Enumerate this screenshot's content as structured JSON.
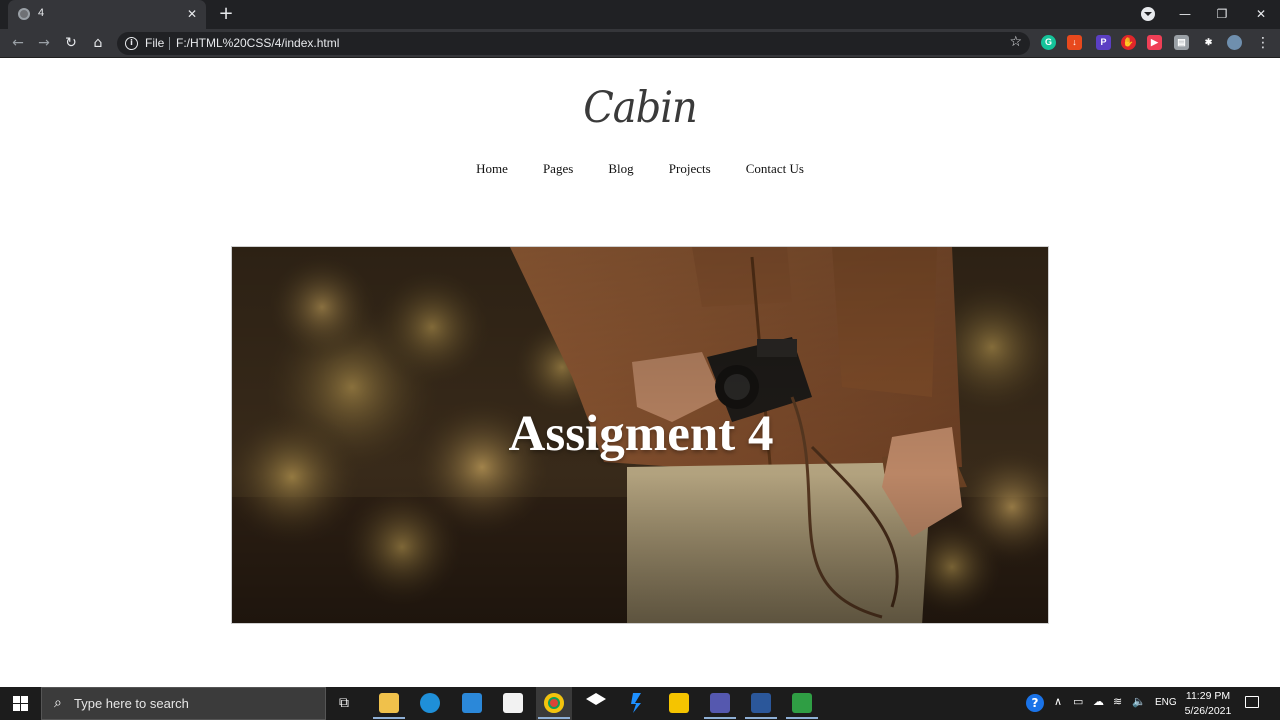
{
  "browser": {
    "tab_title": "4",
    "url_scheme": "File",
    "url": "F:/HTML%20CSS/4/index.html"
  },
  "site": {
    "logo": "Cabin",
    "nav": [
      "Home",
      "Pages",
      "Blog",
      "Projects",
      "Contact Us"
    ],
    "hero_title": "Assigment 4"
  },
  "extensions": [
    {
      "name": "grammarly-icon",
      "color": "#15c39a",
      "glyph": "G"
    },
    {
      "name": "download-extension-icon",
      "color": "#e8491d",
      "glyph": "↓"
    },
    {
      "name": "extension-badge-icon",
      "color": "#5b3fc4",
      "glyph": "P"
    },
    {
      "name": "adblock-icon",
      "color": "#e0262a",
      "glyph": "✋"
    },
    {
      "name": "pocket-icon",
      "color": "#ef3f56",
      "glyph": "▶"
    },
    {
      "name": "extension-grey-icon",
      "color": "#9aa0a6",
      "glyph": "▤"
    },
    {
      "name": "puzzle-icon",
      "color": "#35363a",
      "glyph": "✱"
    },
    {
      "name": "profile-avatar",
      "color": "#6f8fae",
      "glyph": ""
    }
  ],
  "taskbar": {
    "search_placeholder": "Type here to search",
    "language": "ENG",
    "time": "11:29 PM",
    "date": "5/26/2021"
  },
  "colors": {
    "chrome_dark": "#202124",
    "toolbar": "#35363a",
    "taskbar": "#1c1c1c"
  }
}
